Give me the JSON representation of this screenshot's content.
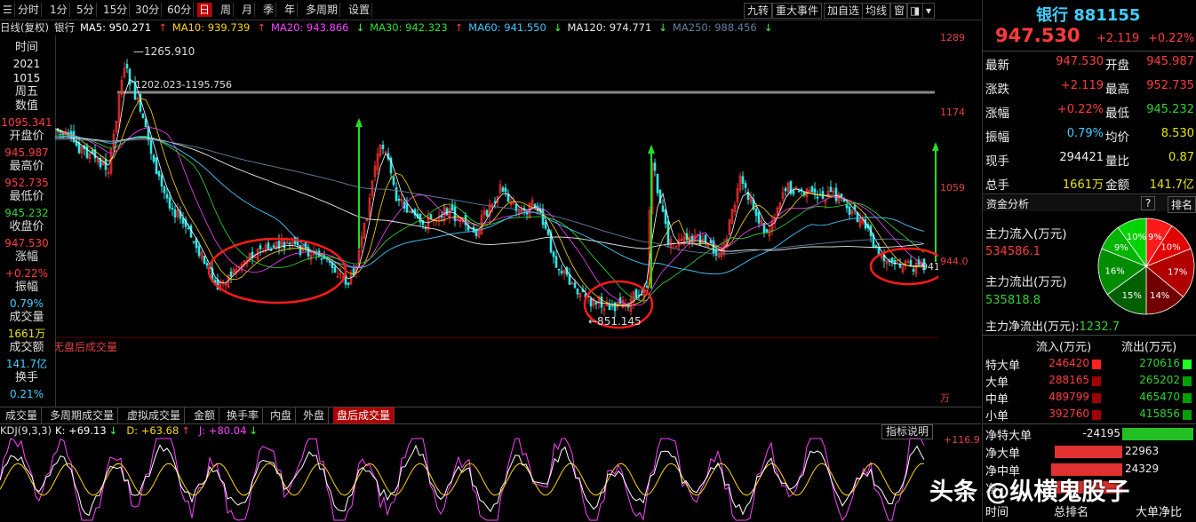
{
  "toolbar": {
    "periods": [
      "分时",
      "1分",
      "5分",
      "15分",
      "30分",
      "60分",
      "日",
      "周",
      "月",
      "季",
      "年",
      "多周期",
      "设置"
    ],
    "active_period": "日",
    "right_buttons": [
      "九转",
      "重大事件",
      "加自选",
      "均线",
      "窗"
    ]
  },
  "ma": {
    "prefix": "日线(复权)",
    "name": "银行",
    "items": [
      {
        "label": "MA5: 950.271",
        "arrow": "↑",
        "color": "#ffffff"
      },
      {
        "label": "MA10: 939.739",
        "arrow": "↑",
        "color": "#ffd700"
      },
      {
        "label": "MA20: 943.866",
        "arrow": "↓",
        "color": "#ff40ff"
      },
      {
        "label": "MA30: 942.323",
        "arrow": "↑",
        "color": "#30e030"
      },
      {
        "label": "MA60: 941.550",
        "arrow": "↓",
        "color": "#40c8ff"
      },
      {
        "label": "MA120: 974.771",
        "arrow": "↓",
        "color": "#e8e8e8"
      },
      {
        "label": "MA250: 988.456",
        "arrow": "↓",
        "color": "#6080a0"
      }
    ]
  },
  "left_panel": [
    {
      "text": "时间",
      "cls": "lbl"
    },
    {
      "text": "2021",
      "cls": "white"
    },
    {
      "text": "1015",
      "cls": "white"
    },
    {
      "text": "周五",
      "cls": "lbl"
    },
    {
      "text": "数值",
      "cls": "lbl"
    },
    {
      "text": "1095.341",
      "cls": "red"
    },
    {
      "text": "开盘价",
      "cls": "lbl"
    },
    {
      "text": "945.987",
      "cls": "red"
    },
    {
      "text": "最高价",
      "cls": "lbl"
    },
    {
      "text": "952.735",
      "cls": "red"
    },
    {
      "text": "最低价",
      "cls": "lbl"
    },
    {
      "text": "945.232",
      "cls": "green"
    },
    {
      "text": "收盘价",
      "cls": "lbl"
    },
    {
      "text": "947.530",
      "cls": "red"
    },
    {
      "text": "涨幅",
      "cls": "lbl"
    },
    {
      "text": "+0.22%",
      "cls": "red"
    },
    {
      "text": "振幅",
      "cls": "lbl"
    },
    {
      "text": "0.79%",
      "cls": "cyan"
    },
    {
      "text": "成交量",
      "cls": "lbl"
    },
    {
      "text": "1661万",
      "cls": "yellow"
    },
    {
      "text": "成交额",
      "cls": "lbl"
    },
    {
      "text": "141.7亿",
      "cls": "cyan"
    },
    {
      "text": "换手",
      "cls": "lbl"
    },
    {
      "text": "0.21%",
      "cls": "cyan"
    }
  ],
  "chart": {
    "axis_labels": [
      "1289",
      "1174",
      "1059",
      "944.0"
    ],
    "axis_unit": "万",
    "high_label": "1265.910",
    "range_label": "1202.023-1195.756",
    "low_label": "851.145",
    "last_label": "941",
    "after_hours_label": "无盘后成交量"
  },
  "tabs": {
    "items": [
      "成交量",
      "多周期成交量",
      "虚拟成交量",
      "金额",
      "换手率",
      "内盘",
      "外盘",
      "盘后成交量"
    ],
    "active": "盘后成交量"
  },
  "kdj": {
    "title": "KDJ(9,3,3)",
    "items": [
      {
        "label": "K: +69.13",
        "arrow": "↓",
        "color": "#ffffff"
      },
      {
        "label": "D: +63.68",
        "arrow": "↑",
        "color": "#ffd700"
      },
      {
        "label": "J: +80.04",
        "arrow": "↓",
        "color": "#ff40ff"
      }
    ],
    "axis_label": "+116.9",
    "help_button": "指标说明"
  },
  "quote": {
    "name_code": "银行 881155",
    "price": "947.530",
    "change": "+2.119",
    "change_pct": "+0.22%",
    "rows": [
      {
        "l1": "最新",
        "v1": "947.530",
        "c1": "red",
        "l2": "开盘",
        "v2": "945.987",
        "c2": "red"
      },
      {
        "l1": "涨跌",
        "v1": "+2.119",
        "c1": "red",
        "l2": "最高",
        "v2": "952.735",
        "c2": "red"
      },
      {
        "l1": "涨幅",
        "v1": "+0.22%",
        "c1": "red",
        "l2": "最低",
        "v2": "945.232",
        "c2": "green"
      },
      {
        "l1": "振幅",
        "v1": "0.79%",
        "c1": "cyan",
        "l2": "均价",
        "v2": "8.530",
        "c2": "yellow"
      },
      {
        "l1": "现手",
        "v1": "294421",
        "c1": "white",
        "l2": "量比",
        "v2": "0.87",
        "c2": "yellow"
      },
      {
        "l1": "总手",
        "v1": "1661万",
        "c1": "yellow",
        "l2": "金额",
        "v2": "141.7亿",
        "c2": "yellow"
      }
    ]
  },
  "fund": {
    "title": "资金分析",
    "help": "?",
    "rank": "排名",
    "inflow_label": "主力流入(万元)",
    "inflow_value": "534586.1",
    "outflow_label": "主力流出(万元)",
    "outflow_value": "535818.8",
    "net_label": "主力净流出(万元):",
    "net_value": "1232.7",
    "pie": [
      {
        "label": "9%",
        "value": 9,
        "color": "#ff1a1a"
      },
      {
        "label": "10%",
        "value": 10,
        "color": "#e00000"
      },
      {
        "label": "17%",
        "value": 17,
        "color": "#b00000"
      },
      {
        "label": "14%",
        "value": 14,
        "color": "#700000"
      },
      {
        "label": "15%",
        "value": 15,
        "color": "#006000"
      },
      {
        "label": "16%",
        "value": 16,
        "color": "#008c00"
      },
      {
        "label": "9%",
        "value": 9,
        "color": "#00b400"
      },
      {
        "label": "10%",
        "value": 10,
        "color": "#00d400"
      }
    ]
  },
  "flow_table": {
    "col_in": "流入(万元)",
    "col_out": "流出(万元)",
    "rows": [
      {
        "label": "特大单",
        "in": "246420",
        "out": "270616"
      },
      {
        "label": "大单",
        "in": "288165",
        "out": "265202"
      },
      {
        "label": "中单",
        "in": "489799",
        "out": "465470"
      },
      {
        "label": "小单",
        "in": "392760",
        "out": "415856"
      }
    ]
  },
  "net_flow": [
    {
      "label": "净特大单",
      "value": "-24195",
      "amount": -24195
    },
    {
      "label": "净大单",
      "value": "22963",
      "amount": 22963
    },
    {
      "label": "净中单",
      "value": "24329",
      "amount": 24329
    },
    {
      "label": "净",
      "value": "",
      "amount": 23000
    }
  ],
  "footer": {
    "time_label": "时间",
    "rank_label": "总排名",
    "ratio_label": "大单净比"
  },
  "watermark": "头条 @纵横鬼股子"
}
